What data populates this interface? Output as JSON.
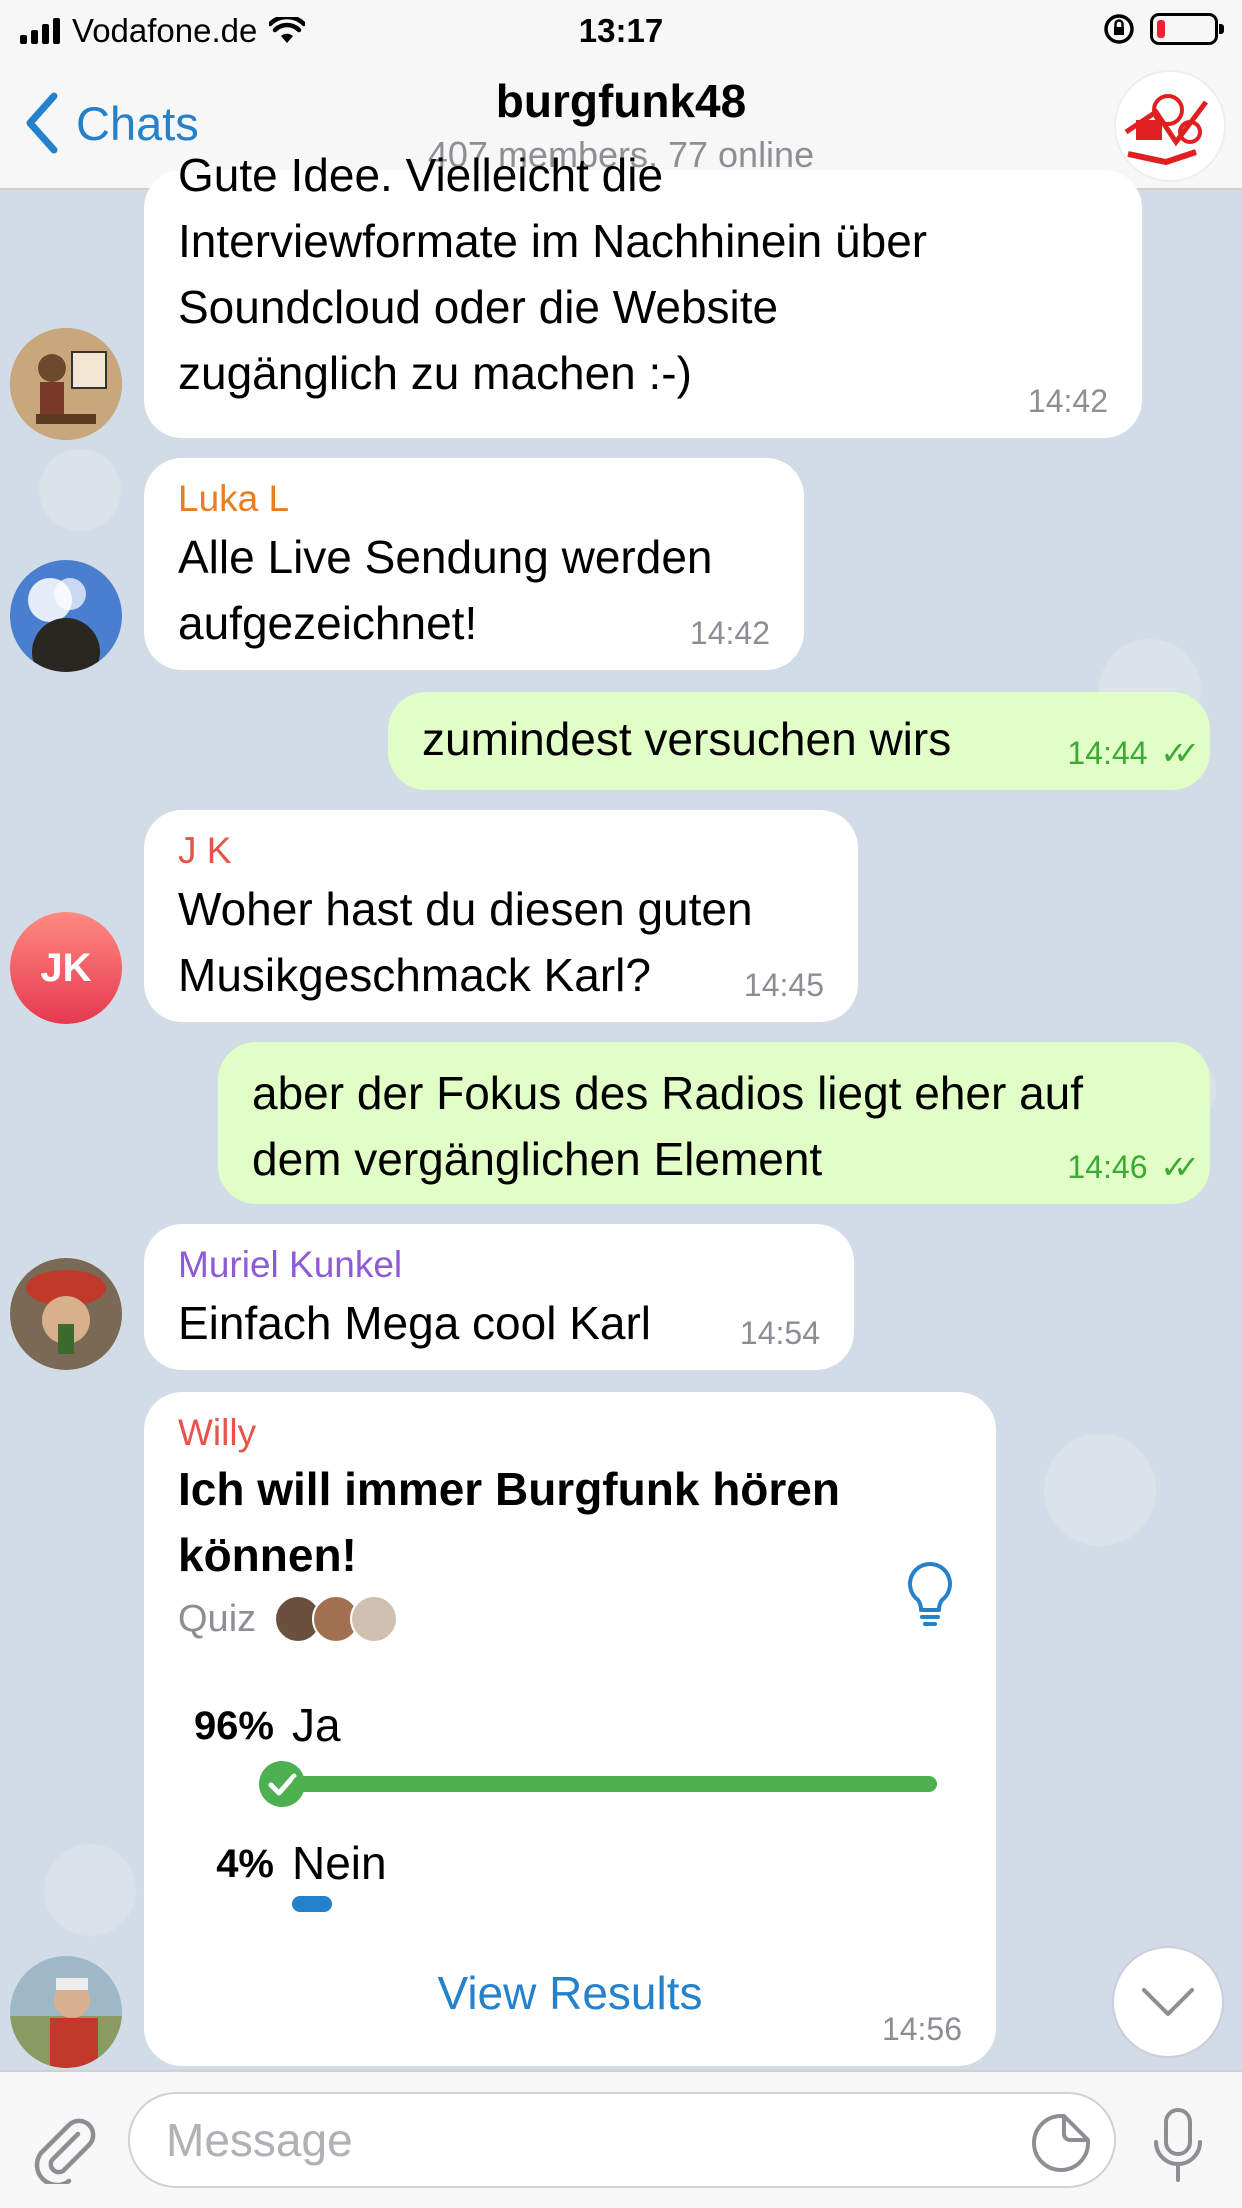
{
  "status_bar": {
    "carrier": "Vodafone.de",
    "time": "13:17"
  },
  "header": {
    "back_label": "Chats",
    "title": "burgfunk48",
    "subtitle": "407 members, 77 online"
  },
  "messages": [
    {
      "direction": "in",
      "text_lines": [
        "Gute Idee. Vielleicht die",
        "Interviewformate im Nachhinein über",
        "Soundcloud oder die Website",
        "zugänglich zu machen :-)"
      ],
      "time": "14:42"
    },
    {
      "direction": "in",
      "sender": "Luka L",
      "sender_color": "#e67e22",
      "text_lines": [
        "Alle Live Sendung werden",
        "aufgezeichnet!"
      ],
      "time": "14:42"
    },
    {
      "direction": "out",
      "text_lines": [
        "zumindest versuchen wirs"
      ],
      "time": "14:44"
    },
    {
      "direction": "in",
      "sender": "J K",
      "sender_color": "#e5534b",
      "avatar_initials": "JK",
      "text_lines": [
        "Woher hast du diesen guten",
        "Musikgeschmack Karl?"
      ],
      "time": "14:45"
    },
    {
      "direction": "out",
      "text_lines": [
        "aber der Fokus des Radios liegt eher auf",
        "dem vergänglichen Element"
      ],
      "time": "14:46"
    },
    {
      "direction": "in",
      "sender": "Muriel Kunkel",
      "sender_color": "#8e5ad6",
      "text_lines": [
        "Einfach Mega cool Karl"
      ],
      "time": "14:54"
    }
  ],
  "poll": {
    "sender": "Willy",
    "sender_color": "#e5534b",
    "question_lines": [
      "Ich will immer Burgfunk hören",
      "können!"
    ],
    "type_label": "Quiz",
    "options": [
      {
        "percent": "96%",
        "label": "Ja",
        "fraction": 0.96,
        "correct": true
      },
      {
        "percent": "4%",
        "label": "Nein",
        "fraction": 0.04,
        "correct": false
      }
    ],
    "view_results_label": "View Results",
    "time": "14:56"
  },
  "input": {
    "placeholder": "Message"
  },
  "colors": {
    "accent": "#2481cc",
    "outgoing_bubble": "#e1fec6",
    "correct_green": "#4caf50"
  },
  "icons": {
    "back": "chevron-left-icon",
    "hint": "lightbulb-icon",
    "attach": "paperclip-icon",
    "sticker": "sticker-icon",
    "mic": "microphone-icon",
    "scroll": "chevron-down-icon"
  }
}
